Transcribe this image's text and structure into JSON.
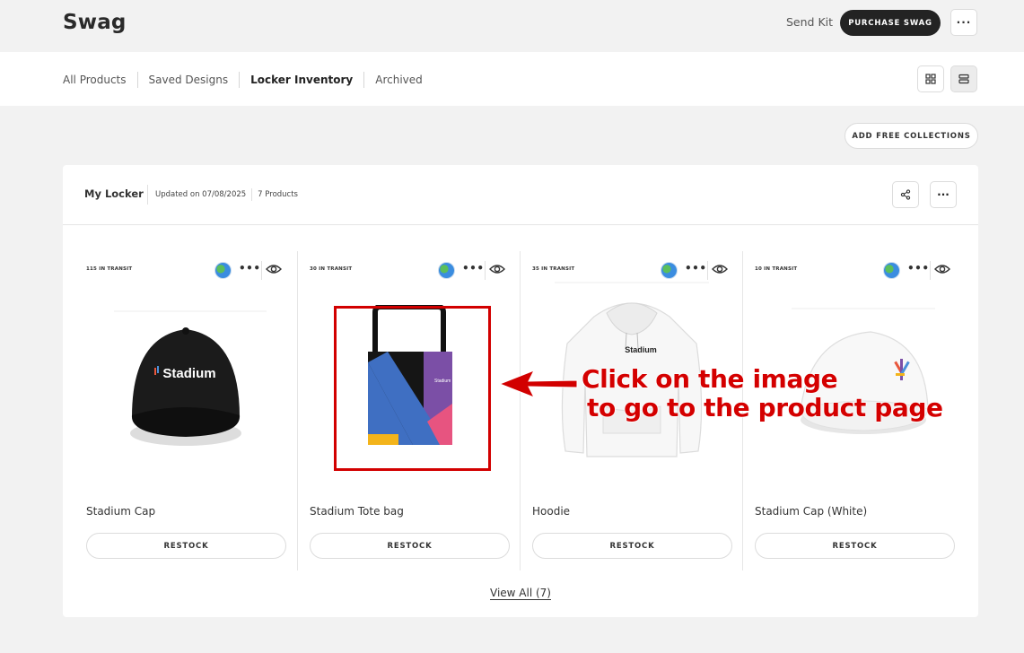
{
  "header": {
    "title": "Swag",
    "send_kit": "Send Kit",
    "purchase": "PURCHASE SWAG",
    "more": "···"
  },
  "tabs": [
    {
      "label": "All Products",
      "active": false
    },
    {
      "label": "Saved Designs",
      "active": false
    },
    {
      "label": "Locker Inventory",
      "active": true
    },
    {
      "label": "Archived",
      "active": false
    }
  ],
  "view_toggle": {
    "grid_icon": "grid-icon",
    "list_icon": "list-icon",
    "selected": "list"
  },
  "add_free_collections": "ADD FREE COLLECTIONS",
  "locker": {
    "title": "My Locker",
    "updated": "Updated on 07/08/2025",
    "count": "7 Products",
    "share_icon": "share-icon",
    "more": "···"
  },
  "products": [
    {
      "transit": "115 IN TRANSIT",
      "name": "Stadium Cap",
      "restock": "RESTOCK",
      "image": "black-cap"
    },
    {
      "transit": "30 IN TRANSIT",
      "name": "Stadium Tote bag",
      "restock": "RESTOCK",
      "image": "tote-bag"
    },
    {
      "transit": "35 IN TRANSIT",
      "name": "Hoodie",
      "restock": "RESTOCK",
      "image": "white-hoodie"
    },
    {
      "transit": "10 IN TRANSIT",
      "name": "Stadium Cap (White)",
      "restock": "RESTOCK",
      "image": "white-cap"
    }
  ],
  "view_all": "View All (7)",
  "annotation": {
    "line1": "Click on the image",
    "line2": "to go to the product page",
    "color": "#d40000"
  },
  "brand": {
    "cap_logo_text": "Stadium",
    "tote_logo_text": "Stadium",
    "hoodie_logo_text": "Stadium"
  }
}
